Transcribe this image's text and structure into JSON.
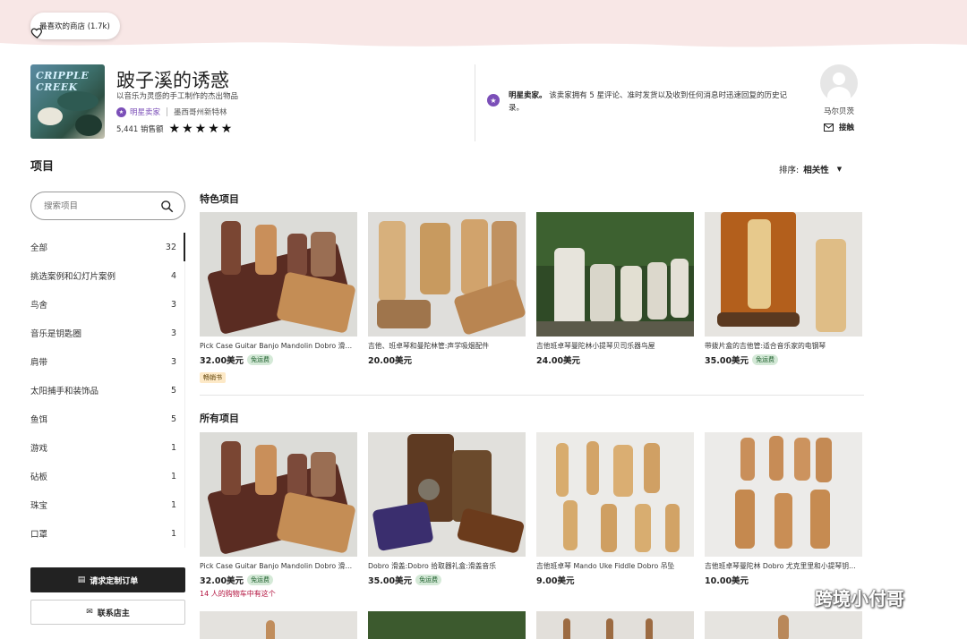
{
  "banner": {
    "favorite_label": "最喜欢的商店 (1.7k)"
  },
  "shop": {
    "name": "跛子溪的诱惑",
    "tagline": "以音乐为灵感的手工制作的杰出物品",
    "star_seller": "明星卖家",
    "location": "墨西哥州新特林",
    "sales": "5,441 销售额",
    "rating": 5,
    "logo_text": "CRIPPLE CREEK"
  },
  "star_seller_note": {
    "title": "明星卖家。",
    "text": "该卖家拥有 5 星评论、准时发货以及收到任何消息时迅速回复的历史记录。"
  },
  "owner": {
    "name": "马尔贝茨",
    "contact_label": "接触"
  },
  "items_title": "项目",
  "sort": {
    "label": "排序:",
    "value": "相关性"
  },
  "sidebar": {
    "search_placeholder": "搜索项目",
    "categories": [
      {
        "label": "全部",
        "count": "32"
      },
      {
        "label": "挑选案例和幻灯片案例",
        "count": "4"
      },
      {
        "label": "鸟舍",
        "count": "3"
      },
      {
        "label": "音乐是钥匙圈",
        "count": "3"
      },
      {
        "label": "肩带",
        "count": "3"
      },
      {
        "label": "太阳捕手和装饰品",
        "count": "5"
      },
      {
        "label": "鱼饵",
        "count": "5"
      },
      {
        "label": "游戏",
        "count": "1"
      },
      {
        "label": "砧板",
        "count": "1"
      },
      {
        "label": "珠宝",
        "count": "1"
      },
      {
        "label": "口罩",
        "count": "1"
      }
    ],
    "custom_order_label": "请求定制订单",
    "contact_owner_label": "联系店主"
  },
  "featured": {
    "title": "特色项目",
    "items": [
      {
        "title": "Pick Case Guitar Banjo Mandolin Dobro 滑盖盒",
        "price": "32.00美元",
        "free_shipping": "免运费",
        "badge": "畅销书"
      },
      {
        "title": "吉他、班卓琴和曼陀林管:声学吸烟配件",
        "price": "20.00美元",
        "free_shipping": "",
        "badge": ""
      },
      {
        "title": "吉他班卓琴曼陀林小提琴贝司乐器鸟屋",
        "price": "24.00美元",
        "free_shipping": "",
        "badge": ""
      },
      {
        "title": "带拨片盒的吉他管:适合音乐家的电钢琴",
        "price": "35.00美元",
        "free_shipping": "免运费",
        "badge": ""
      }
    ]
  },
  "all_items": {
    "title": "所有项目",
    "items": [
      {
        "title": "Pick Case Guitar Banjo Mandolin Dobro 滑盖盒",
        "price": "32.00美元",
        "free_shipping": "免运费",
        "note": "14 人的购物车中有这个"
      },
      {
        "title": "Dobro 滑盖:Dobro 拾取器礼盒:滑盖音乐",
        "price": "35.00美元",
        "free_shipping": "免运费",
        "note": ""
      },
      {
        "title": "吉他班卓琴 Mando Uke Fiddle Dobro 吊坠",
        "price": "9.00美元",
        "free_shipping": "",
        "note": ""
      },
      {
        "title": "吉他班卓琴曼陀林 Dobro 尤克里里和小提琴钥匙扣",
        "price": "10.00美元",
        "free_shipping": "",
        "note": ""
      }
    ]
  },
  "watermark": {
    "text": "跨境小付哥"
  },
  "colors": {
    "banner": "#f8e7e6",
    "star_seller": "#7b4fb8",
    "free_shipping_bg": "#d4e9d7",
    "bestseller_bg": "#fde9c7",
    "cart_note": "#b3123e"
  }
}
